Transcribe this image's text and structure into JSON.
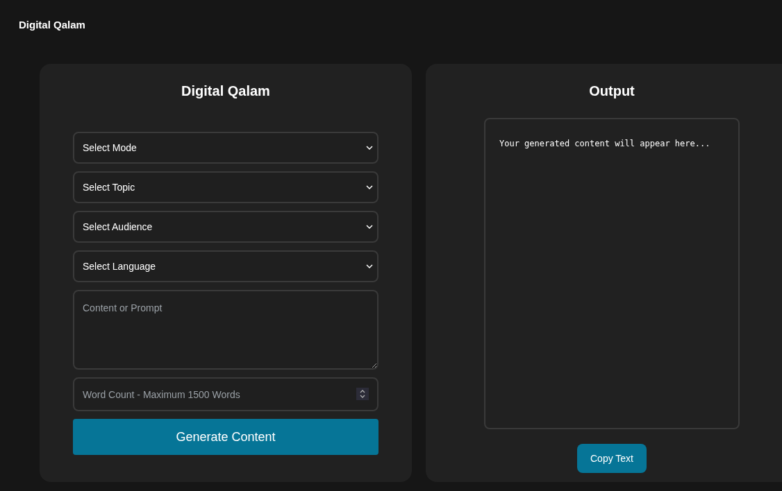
{
  "header": {
    "title": "Digital Qalam"
  },
  "form": {
    "title": "Digital Qalam",
    "selects": [
      {
        "label": "Select Mode"
      },
      {
        "label": "Select Topic"
      },
      {
        "label": "Select Audience"
      },
      {
        "label": "Select Language"
      }
    ],
    "prompt": {
      "placeholder": "Content or Prompt"
    },
    "word_count": {
      "placeholder": "Word Count - Maximum 1500 Words"
    },
    "button": "Generate Content"
  },
  "output": {
    "title": "Output",
    "text": "Your generated content will appear here...",
    "button": "Copy Text"
  }
}
